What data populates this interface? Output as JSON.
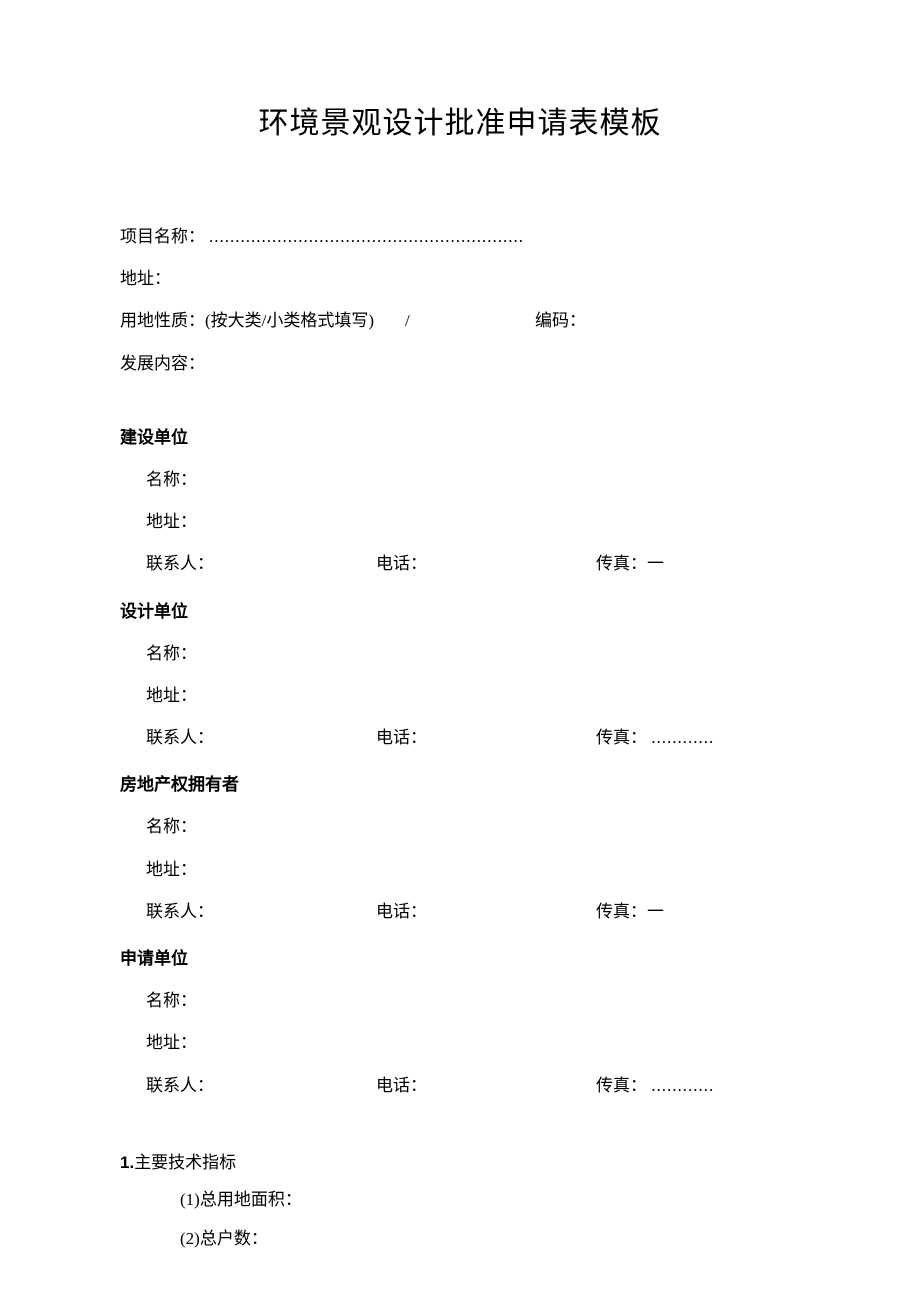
{
  "title": "环境景观设计批准申请表模板",
  "project": {
    "name_label": "项目名称：",
    "name_value": "............................................................",
    "address_label": "地址：",
    "land_use_label": "用地性质：(按大类/小类格式填写)",
    "slash": "/",
    "code_label": "编码：",
    "dev_content_label": "发展内容："
  },
  "sections": {
    "construction": {
      "header": "建设单位",
      "name_label": "名称：",
      "address_label": "地址：",
      "contact_label": "联系人：",
      "phone_label": "电话：",
      "fax_label": "传真：一"
    },
    "design": {
      "header": "设计单位",
      "name_label": "名称：",
      "address_label": "地址：",
      "contact_label": "联系人：",
      "phone_label": "电话：",
      "fax_label": "传真：",
      "fax_value": "............"
    },
    "owner": {
      "header": "房地产权拥有者",
      "name_label": "名称：",
      "address_label": "地址：",
      "contact_label": "联系人：",
      "phone_label": "电话：",
      "fax_label": "传真：一"
    },
    "applicant": {
      "header": "申请单位",
      "name_label": "名称：",
      "address_label": "地址：",
      "contact_label": "联系人：",
      "phone_label": "电话：",
      "fax_label": "传真：",
      "fax_value": "............"
    }
  },
  "tech": {
    "num": "1.",
    "header": "主要技术指标",
    "item1": "(1)总用地面积：",
    "item2": "(2)总户数："
  }
}
